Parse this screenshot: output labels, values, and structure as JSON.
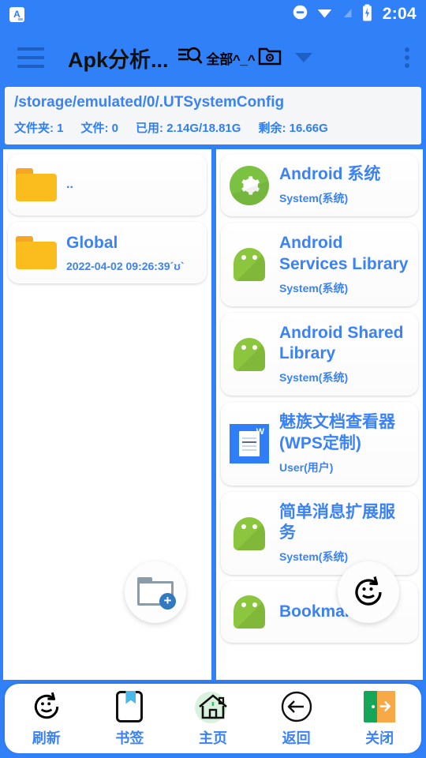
{
  "statusbar": {
    "app_badge": "A",
    "icons": [
      "dnd-icon",
      "wifi-icon",
      "signal-off-icon",
      "battery-charging-icon"
    ],
    "time": "2:04"
  },
  "appbar": {
    "menu_icon": "hamburger-menu-icon",
    "title": "Apk分析...",
    "search_icon": "filter-search-icon",
    "filter_label": "全部^_^",
    "folder_settings_icon": "folder-settings-icon",
    "dropdown_icon": "chevron-down-icon",
    "overflow_icon": "overflow-menu-icon"
  },
  "pathbar": {
    "path": "/storage/emulated/0/.UTSystemConfig",
    "stats": [
      "文件夹: 1",
      "文件: 0",
      "已用: 2.14G/18.81G",
      "剩余: 16.66G"
    ]
  },
  "file_list": [
    {
      "name": "..",
      "date": "",
      "icon": "folder-icon"
    },
    {
      "name": "Global",
      "date": "2022-04-02 09:26:39´ʊ`",
      "icon": "folder-icon"
    }
  ],
  "app_list": [
    {
      "name": "Android 系统",
      "type": "System(系统)",
      "icon": "gear-circle-icon"
    },
    {
      "name": "Android Services Library",
      "type": "System(系统)",
      "icon": "android-robot-icon"
    },
    {
      "name": "Android Shared Library",
      "type": "System(系统)",
      "icon": "android-robot-icon"
    },
    {
      "name": "魅族文档查看器(WPS定制)",
      "type": "User(用户)",
      "icon": "wps-document-icon"
    },
    {
      "name": "简单消息扩展服务",
      "type": "System(系统)",
      "icon": "android-robot-icon"
    },
    {
      "name": "Bookmark",
      "type": "",
      "icon": "android-robot-icon"
    }
  ],
  "fabs": {
    "new_folder": "new-folder-icon",
    "refresh": "refresh-smiley-icon"
  },
  "bottomnav": [
    {
      "label": "刷新",
      "icon": "refresh-smiley-icon"
    },
    {
      "label": "书签",
      "icon": "bookmark-icon"
    },
    {
      "label": "主页",
      "icon": "home-icon"
    },
    {
      "label": "返回",
      "icon": "back-arrow-icon"
    },
    {
      "label": "关闭",
      "icon": "exit-door-icon"
    }
  ],
  "colors": {
    "accent": "#3080f7",
    "card_text": "#3b82f6",
    "folder": "#fbbc1e",
    "android_green": "#8cc63e"
  }
}
